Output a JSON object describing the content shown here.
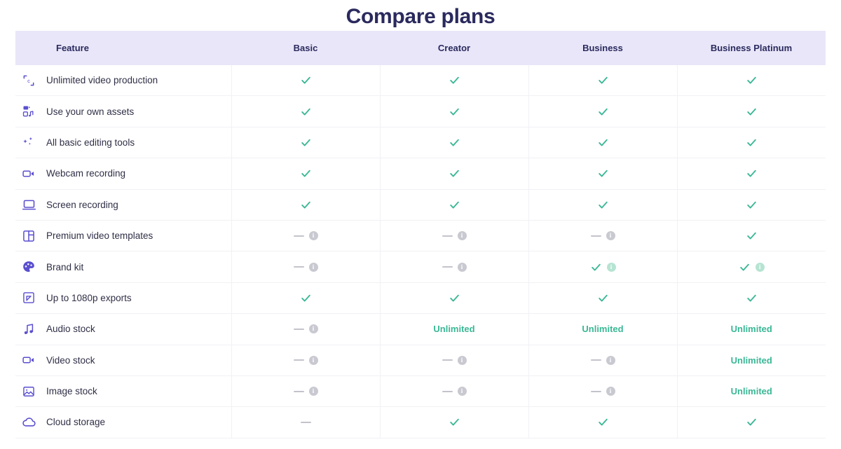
{
  "page": {
    "title": "Compare plans",
    "title_color": "#2a2a5e"
  },
  "colors": {
    "header_bg": "#e9e6f9",
    "icon_purple": "#5a4fcf",
    "check_green": "#3ab795",
    "unlimited_green": "#3ab795",
    "dash_gray": "#c3c3cc",
    "info_gray": "#c9c9d1",
    "info_green": "#b6e4d3",
    "row_border": "#f1f1f6"
  },
  "table": {
    "columns": [
      {
        "key": "feature",
        "label": "Feature"
      },
      {
        "key": "basic",
        "label": "Basic"
      },
      {
        "key": "creator",
        "label": "Creator"
      },
      {
        "key": "business",
        "label": "Business"
      },
      {
        "key": "business_platinum",
        "label": "Business Platinum"
      }
    ],
    "rows": [
      {
        "icon": "crop-frame-icon",
        "feature": "Unlimited video production",
        "basic": {
          "type": "check"
        },
        "creator": {
          "type": "check"
        },
        "business": {
          "type": "check"
        },
        "business_platinum": {
          "type": "check"
        }
      },
      {
        "icon": "media-assets-icon",
        "feature": "Use your own assets",
        "basic": {
          "type": "check"
        },
        "creator": {
          "type": "check"
        },
        "business": {
          "type": "check"
        },
        "business_platinum": {
          "type": "check"
        }
      },
      {
        "icon": "sparkles-icon",
        "feature": "All basic editing tools",
        "basic": {
          "type": "check"
        },
        "creator": {
          "type": "check"
        },
        "business": {
          "type": "check"
        },
        "business_platinum": {
          "type": "check"
        }
      },
      {
        "icon": "video-camera-icon",
        "feature": "Webcam recording",
        "basic": {
          "type": "check"
        },
        "creator": {
          "type": "check"
        },
        "business": {
          "type": "check"
        },
        "business_platinum": {
          "type": "check"
        }
      },
      {
        "icon": "laptop-icon",
        "feature": "Screen recording",
        "basic": {
          "type": "check"
        },
        "creator": {
          "type": "check"
        },
        "business": {
          "type": "check"
        },
        "business_platinum": {
          "type": "check"
        }
      },
      {
        "icon": "layout-template-icon",
        "feature": "Premium video templates",
        "basic": {
          "type": "dash-info"
        },
        "creator": {
          "type": "dash-info"
        },
        "business": {
          "type": "dash-info"
        },
        "business_platinum": {
          "type": "check"
        }
      },
      {
        "icon": "palette-icon",
        "feature": "Brand kit",
        "basic": {
          "type": "dash-info"
        },
        "creator": {
          "type": "dash-info"
        },
        "business": {
          "type": "check-info-green"
        },
        "business_platinum": {
          "type": "check-info-green"
        }
      },
      {
        "icon": "export-frame-icon",
        "feature": "Up to 1080p exports",
        "basic": {
          "type": "check"
        },
        "creator": {
          "type": "check"
        },
        "business": {
          "type": "check"
        },
        "business_platinum": {
          "type": "check"
        }
      },
      {
        "icon": "music-note-icon",
        "feature": "Audio stock",
        "basic": {
          "type": "dash-info"
        },
        "creator": {
          "type": "text",
          "text": "Unlimited"
        },
        "business": {
          "type": "text",
          "text": "Unlimited"
        },
        "business_platinum": {
          "type": "text",
          "text": "Unlimited"
        }
      },
      {
        "icon": "video-camera-icon",
        "feature": "Video stock",
        "basic": {
          "type": "dash-info"
        },
        "creator": {
          "type": "dash-info"
        },
        "business": {
          "type": "dash-info"
        },
        "business_platinum": {
          "type": "text",
          "text": "Unlimited"
        }
      },
      {
        "icon": "image-icon",
        "feature": "Image stock",
        "basic": {
          "type": "dash-info"
        },
        "creator": {
          "type": "dash-info"
        },
        "business": {
          "type": "dash-info"
        },
        "business_platinum": {
          "type": "text",
          "text": "Unlimited"
        }
      },
      {
        "icon": "cloud-icon",
        "feature": "Cloud storage",
        "basic": {
          "type": "dash"
        },
        "creator": {
          "type": "check"
        },
        "business": {
          "type": "check"
        },
        "business_platinum": {
          "type": "check"
        }
      }
    ]
  }
}
